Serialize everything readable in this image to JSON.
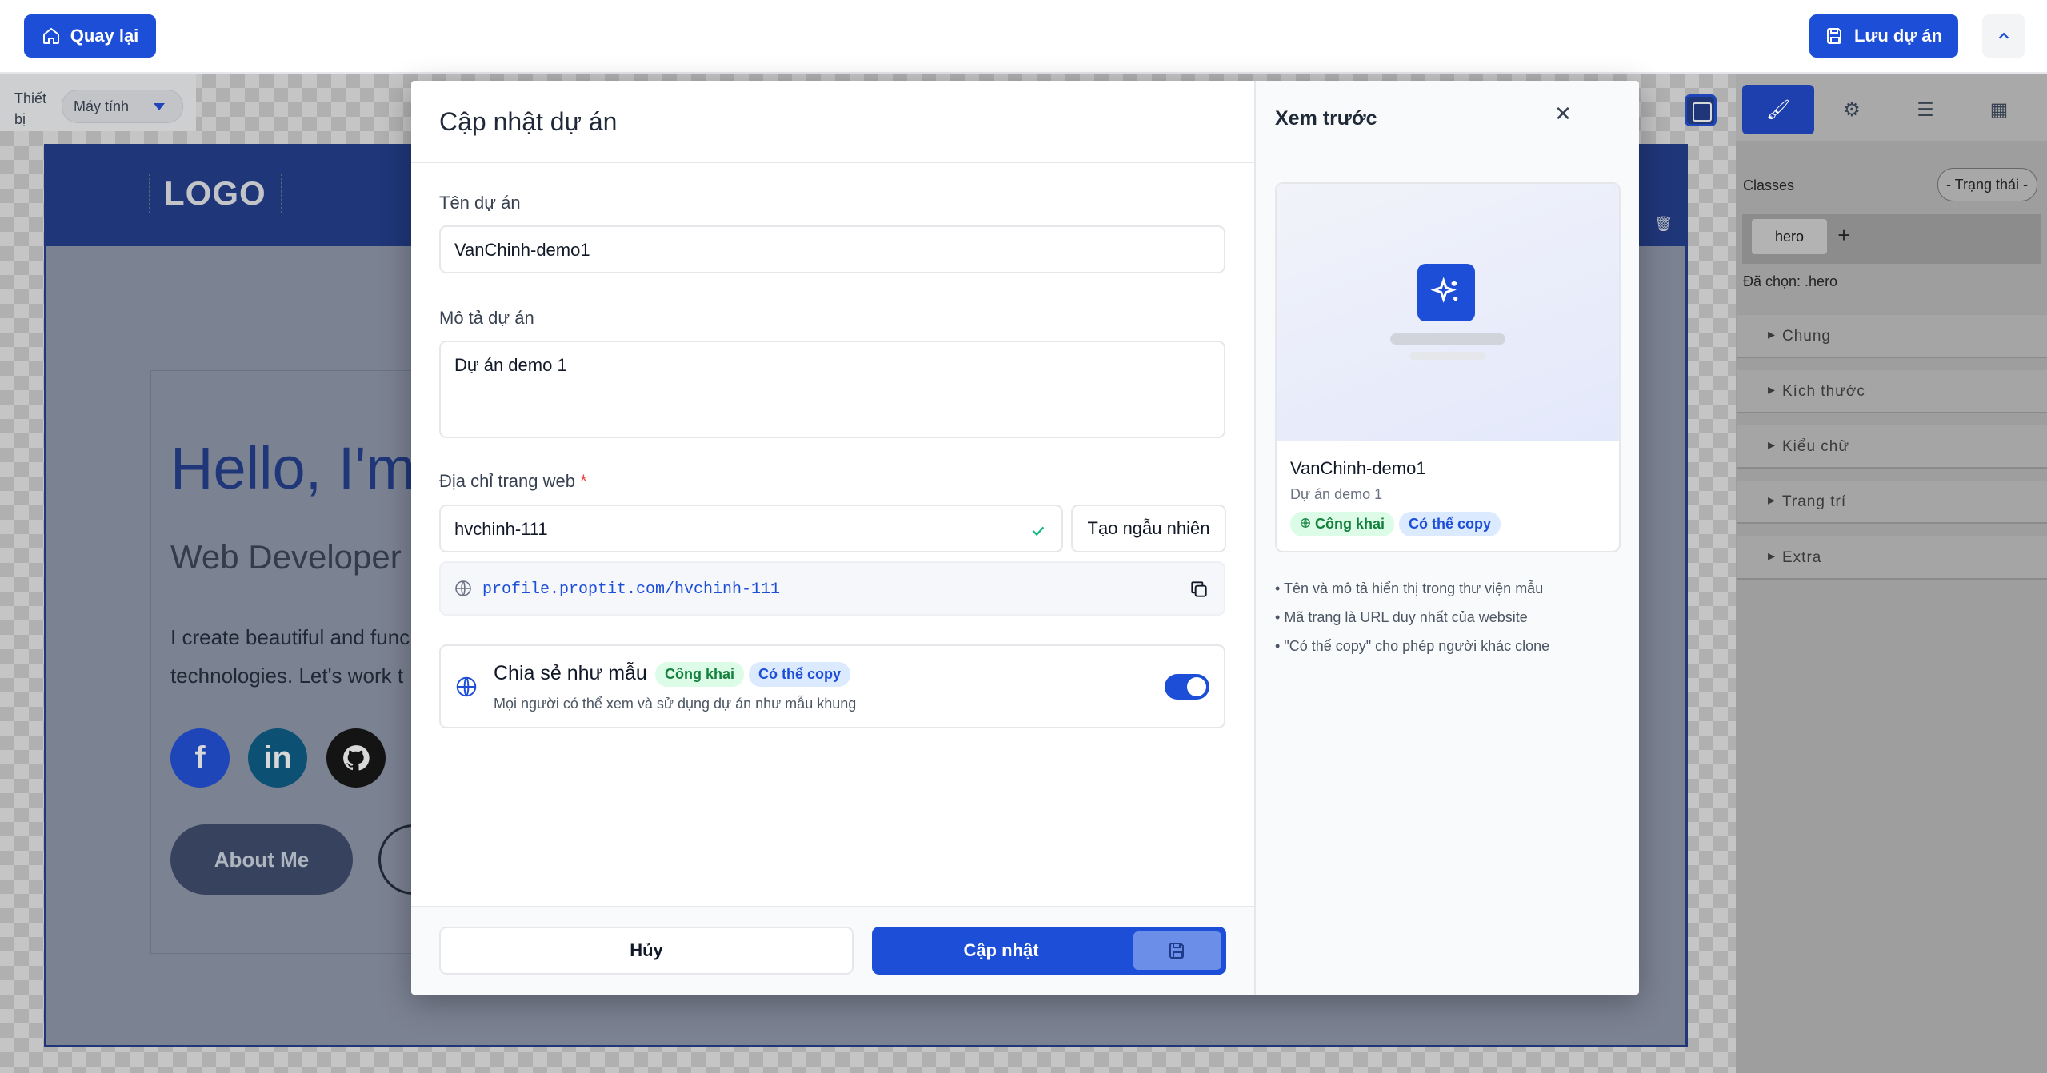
{
  "topbar": {
    "back_label": "Quay lại",
    "save_label": "Lưu dự án"
  },
  "editor": {
    "device_label": "Thiết bị",
    "device_value": "Máy tính",
    "logo": "LOGO",
    "hero_title": "Hello, I'm",
    "hero_sub": "Web Developer",
    "hero_text_1": "I create beautiful and func",
    "hero_text_2": "technologies. Let's work t",
    "about_button": "About Me"
  },
  "style_panel": {
    "classes_label": "Classes",
    "state_value": "- Trạng thái -",
    "class_tag": "hero",
    "selected_label": "Đã chọn: .hero",
    "sections": [
      "Chung",
      "Kích thước",
      "Kiểu chữ",
      "Trang trí",
      "Extra"
    ]
  },
  "modal": {
    "title": "Cập nhật dự án",
    "name_label": "Tên dự án",
    "name_value": "VanChinh-demo1",
    "desc_label": "Mô tả dự án",
    "desc_value": "Dự án demo 1",
    "url_label": "Địa chỉ trang web",
    "url_required": "*",
    "url_value": "hvchinh-111",
    "random_button": "Tạo ngẫu nhiên",
    "url_preview": "profile.proptit.com/hvchinh-111",
    "share_title": "Chia sẻ như mẫu",
    "badge_public": "Công khai",
    "badge_copy": "Có thể copy",
    "share_desc": "Mọi người có thể xem và sử dụng dự án như mẫu khung",
    "share_enabled": true,
    "cancel_label": "Hủy",
    "update_label": "Cập nhật"
  },
  "preview": {
    "title": "Xem trước",
    "card_name": "VanChinh-demo1",
    "card_desc": "Dự án demo 1",
    "badge_public": "Công khai",
    "badge_copy": "Có thể copy",
    "tips": [
      "Tên và mô tả hiển thị trong thư viện mẫu",
      "Mã trang là URL duy nhất của website",
      "\"Có thể copy\" cho phép người khác clone"
    ]
  },
  "colors": {
    "primary": "#1d4ed8",
    "success": "#10b981",
    "required": "#ef4444"
  }
}
